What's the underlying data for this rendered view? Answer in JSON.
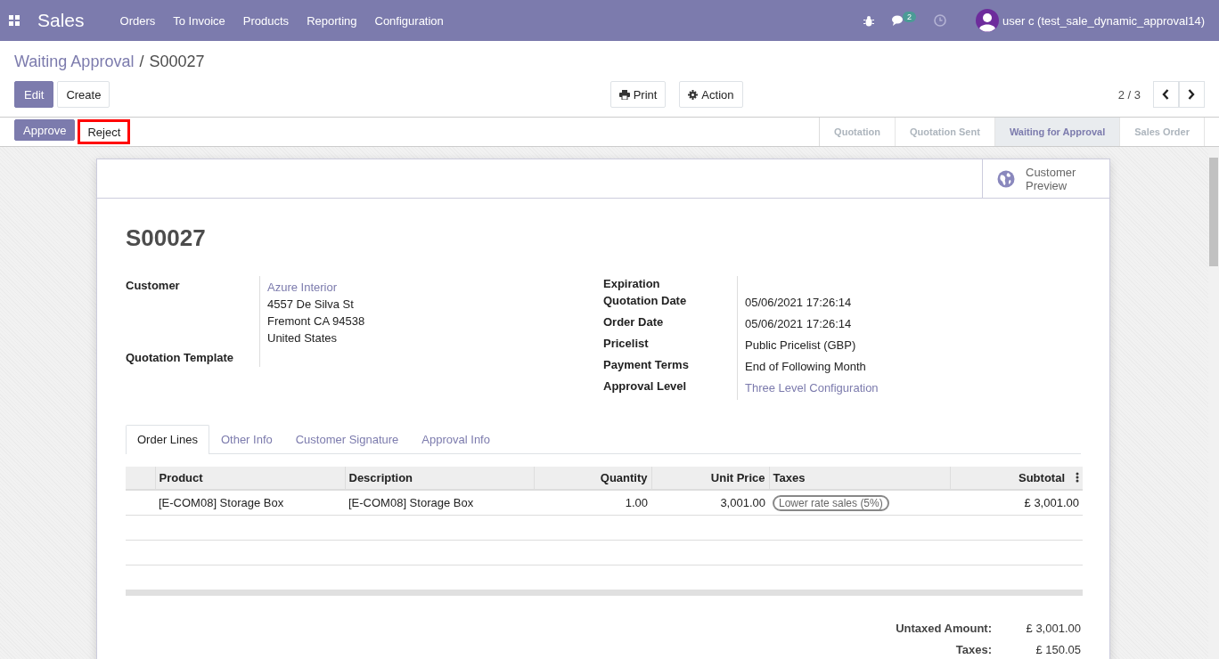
{
  "navbar": {
    "app": "Sales",
    "menu": [
      "Orders",
      "To Invoice",
      "Products",
      "Reporting",
      "Configuration"
    ],
    "chat_count": "2",
    "user": "user c (test_sale_dynamic_approval14)"
  },
  "breadcrumb": {
    "items": [
      {
        "label": "Waiting Approval",
        "kind": "link"
      },
      {
        "label": "S00027",
        "kind": "current"
      }
    ],
    "separator": "/"
  },
  "control_buttons": [
    {
      "label": "Edit",
      "kind": "primary"
    },
    {
      "label": "Create",
      "kind": "secondary"
    }
  ],
  "action_buttons": [
    {
      "label": "Print",
      "kind": "print"
    },
    {
      "label": "Action",
      "kind": "action"
    }
  ],
  "pager": "2 / 3",
  "header_buttons": [
    {
      "label": "Approve",
      "kind": "primary",
      "highlighted": false
    },
    {
      "label": "Reject",
      "kind": "secondary",
      "highlighted": true
    }
  ],
  "stages": [
    {
      "label": "Quotation",
      "selected": false
    },
    {
      "label": "Quotation Sent",
      "selected": false
    },
    {
      "label": "Waiting for Approval",
      "selected": true
    },
    {
      "label": "Sales Order",
      "selected": false
    }
  ],
  "sheet": {
    "button_box": "Customer Preview",
    "title": "S00027",
    "left_fields": [
      {
        "label": "Customer",
        "link": "Azure Interior",
        "lines": [
          "4557 De Silva St",
          "Fremont CA 94538",
          "United States"
        ]
      },
      {
        "label": "Quotation Template"
      }
    ],
    "right_fields": [
      {
        "label": "Expiration"
      },
      {
        "label": "Quotation Date",
        "lines": [
          "05/06/2021 17:26:14"
        ]
      },
      {
        "label": "Order Date",
        "lines": [
          "05/06/2021 17:26:14"
        ]
      },
      {
        "label": "Pricelist",
        "lines": [
          "Public Pricelist (GBP)"
        ]
      },
      {
        "label": "Payment Terms",
        "lines": [
          "End of Following Month"
        ]
      },
      {
        "label": "Approval Level",
        "link": "Three Level Configuration"
      }
    ],
    "tabs": [
      {
        "label": "Order Lines",
        "selected": true
      },
      {
        "label": "Other Info",
        "selected": false
      },
      {
        "label": "Customer Signature",
        "selected": false
      },
      {
        "label": "Approval Info",
        "selected": false
      }
    ],
    "table": {
      "columns": [
        "Product",
        "Description",
        "Quantity",
        "Unit Price",
        "Taxes",
        "Subtotal"
      ],
      "rows": [
        {
          "cells": [
            "[E-COM08] Storage Box",
            "[E-COM08] Storage Box",
            "1.00",
            "3,001.00"
          ],
          "tag": "Lower rate sales (5%)",
          "subtotal": "£ 3,001.00"
        }
      ]
    },
    "totals": [
      {
        "label": "Untaxed Amount:",
        "value": "£ 3,001.00"
      },
      {
        "label": "Taxes:",
        "value": "£ 150.05"
      }
    ]
  }
}
